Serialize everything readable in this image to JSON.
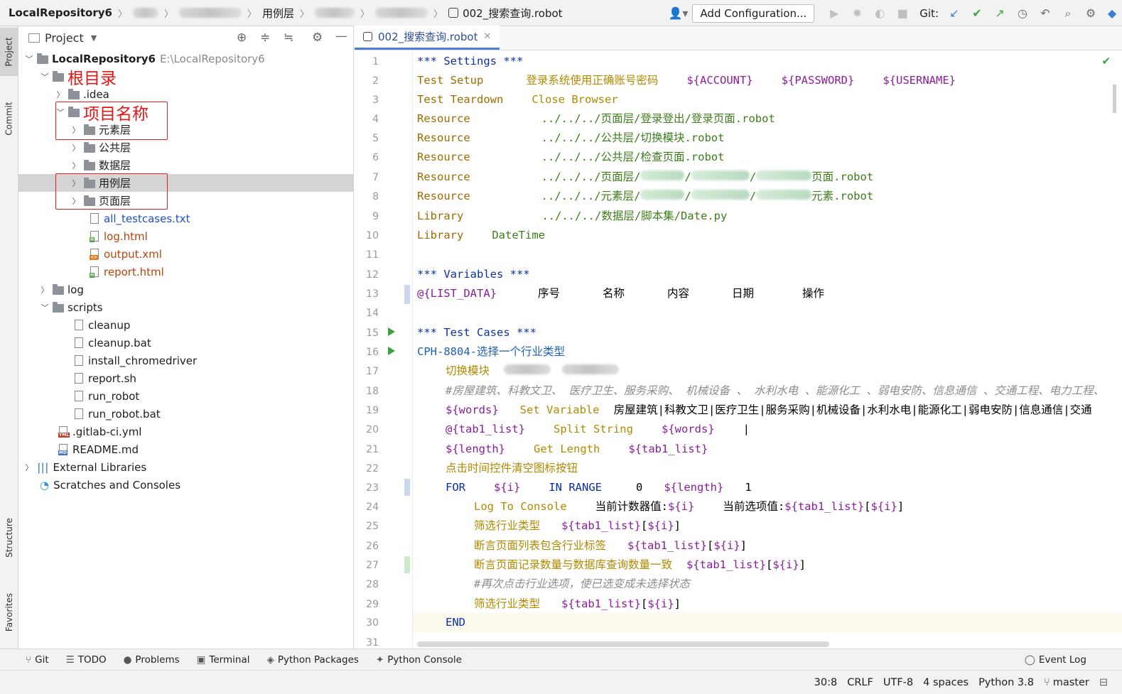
{
  "nav": {
    "repo": "LocalRepository6",
    "crumb3": "用例层",
    "file": "002_搜索查询.robot",
    "add_config": "Add Configuration...",
    "git_label": "Git:"
  },
  "left_tabs": {
    "project": "Project",
    "commit": "Commit",
    "structure": "Structure",
    "favorites": "Favorites"
  },
  "project_panel": {
    "title": "Project",
    "root_name": "LocalRepository6",
    "root_path": "E:\\LocalRepository6",
    "annotation_root": "根目录",
    "annotation_project": "项目名称",
    "items": [
      {
        "label": ".idea"
      },
      {
        "label": "元素层"
      },
      {
        "label": "公共层"
      },
      {
        "label": "数据层"
      },
      {
        "label": "用例层"
      },
      {
        "label": "页面层"
      },
      {
        "label": "all_testcases.txt"
      },
      {
        "label": "log.html"
      },
      {
        "label": "output.xml"
      },
      {
        "label": "report.html"
      },
      {
        "label": "log"
      },
      {
        "label": "scripts"
      },
      {
        "label": "cleanup"
      },
      {
        "label": "cleanup.bat"
      },
      {
        "label": "install_chromedriver"
      },
      {
        "label": "report.sh"
      },
      {
        "label": "run_robot"
      },
      {
        "label": "run_robot.bat"
      },
      {
        "label": ".gitlab-ci.yml"
      },
      {
        "label": "README.md"
      },
      {
        "label": "External Libraries"
      },
      {
        "label": "Scratches and Consoles"
      }
    ]
  },
  "editor": {
    "tab": "002_搜索查询.robot",
    "lines": {
      "l1": "*** Settings ***",
      "l2a": "Test Setup",
      "l2b": "登录系统使用正确账号密码",
      "l2c": "${ACCOUNT}",
      "l2d": "${PASSWORD}",
      "l2e": "${USERNAME}",
      "l3a": "Test Teardown",
      "l3b": "Close Browser",
      "res": "Resource",
      "l4": "../../../页面层/登录登出/登录页面.robot",
      "l5": "../../../公共层/切换模块.robot",
      "l6": "../../../公共层/检查页面.robot",
      "l7a": "../../../页面层/",
      "l7b": "/",
      "l7c": "/",
      "l7d": "页面.robot",
      "l8a": "../../../元素层/",
      "l8b": "/",
      "l8c": "/",
      "l8d": "元素.robot",
      "lib": "Library",
      "l9": "../../../数据层/脚本集/Date.py",
      "l10": "DateTime",
      "l12": "*** Variables ***",
      "l13a": "@{LIST_DATA}",
      "l13b": "序号",
      "l13c": "名称",
      "l13d": "内容",
      "l13e": "日期",
      "l13f": "操作",
      "l15": "*** Test Cases ***",
      "l16": "CPH-8804-选择一个行业类型",
      "l17": "切换模块",
      "l18": "#房屋建筑、科教文卫、 医疗卫生、服务采购、 机械设备 、 水利水电 、能源化工 、弱电安防、信息通信 、交通工程、电力工程、",
      "l19a": "${words}",
      "l19b": "Set Variable",
      "l19c": "房屋建筑|科教文卫|医疗卫生|服务采购|机械设备|水利水电|能源化工|弱电安防|信息通信|交通",
      "l20a": "@{tab1_list}",
      "l20b": "Split String",
      "l20c": "${words}",
      "l20d": "|",
      "l21a": "${length}",
      "l21b": "Get Length",
      "l21c": "${tab1_list}",
      "l22": "点击时间控件清空图标按钮",
      "l23a": "FOR",
      "l23b": "${i}",
      "l23c": "IN RANGE",
      "l23d": "0",
      "l23e": "${length}",
      "l23f": "1",
      "l24a": "Log To Console",
      "l24b": "当前计数器值:",
      "l24c": "${i}",
      "l24d": "当前选项值:",
      "l24e": "${tab1_list}",
      "l24f": "[",
      "l24g": "${i}",
      "l24h": "]",
      "l25a": "筛选行业类型",
      "l25b": "${tab1_list}",
      "l25c": "[",
      "l25d": "${i}",
      "l25e": "]",
      "l26a": "断言页面列表包含行业标签",
      "l26b": "${tab1_list}",
      "l26c": "[",
      "l26d": "${i}",
      "l26e": "]",
      "l27a": "断言页面记录数量与数据库查询数量一致",
      "l27b": "${tab1_list}",
      "l27c": "[",
      "l27d": "${i}",
      "l27e": "]",
      "l28": "#再次点击行业选项，使已选变成未选择状态",
      "l29a": "筛选行业类型",
      "l29b": "${tab1_list}",
      "l29c": "[",
      "l29d": "${i}",
      "l29e": "]",
      "l30": "END"
    }
  },
  "bottom_tools": {
    "git": "Git",
    "todo": "TODO",
    "problems": "Problems",
    "terminal": "Terminal",
    "packages": "Python Packages",
    "console": "Python Console",
    "eventlog": "Event Log"
  },
  "status": {
    "pos": "30:8",
    "eol": "CRLF",
    "enc": "UTF-8",
    "indent": "4 spaces",
    "python": "Python 3.8",
    "branch": "master"
  }
}
